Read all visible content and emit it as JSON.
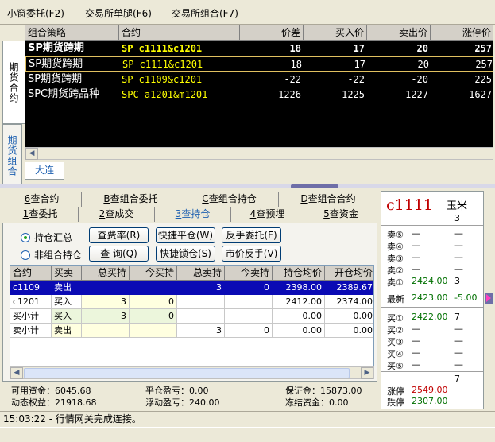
{
  "menubar": {
    "items": [
      "小窗委托(F2)",
      "交易所单腿(F6)",
      "交易所组合(F7)"
    ]
  },
  "left_tabs": [
    "期货合约",
    "期货组合"
  ],
  "quote_grid": {
    "headers": [
      "组合策略",
      "合约",
      "价差",
      "买入价",
      "卖出价",
      "涨停价"
    ],
    "rows": [
      {
        "strategy": "SP期货跨期",
        "contract": "SP c1111&c1201",
        "spread": "18",
        "bid": "17",
        "ask": "20",
        "limit_up": "257"
      },
      {
        "strategy": "SP期货跨期",
        "contract": "SP c1111&c1201",
        "spread": "18",
        "bid": "17",
        "ask": "20",
        "limit_up": "257"
      },
      {
        "strategy": "SP期货跨期",
        "contract": "SP c1109&c1201",
        "spread": "-22",
        "bid": "-22",
        "ask": "-20",
        "limit_up": "225"
      },
      {
        "strategy": "SPC期货跨品种",
        "contract": "SPC a1201&m1201",
        "spread": "1226",
        "bid": "1225",
        "ask": "1227",
        "limit_up": "1627"
      }
    ]
  },
  "exchange_tab": "大连",
  "lower_tabs": {
    "row1": [
      {
        "key": "6",
        "label": "查合约"
      },
      {
        "key": "B",
        "label": "查组合委托"
      },
      {
        "key": "C",
        "label": "查组合持仓"
      },
      {
        "key": "D",
        "label": "查组合合约"
      }
    ],
    "row2": [
      {
        "key": "1",
        "label": "查委托"
      },
      {
        "key": "2",
        "label": "查成交"
      },
      {
        "key": "3",
        "label": "查持仓"
      },
      {
        "key": "4",
        "label": "查预埋"
      },
      {
        "key": "5",
        "label": "查资金"
      }
    ]
  },
  "radios": {
    "summary": "持仓汇总",
    "non_combo": "非组合持仓"
  },
  "buttons": {
    "fee_rate": "查费率(R)",
    "quick_close": "快捷平仓(W)",
    "reverse_order": "反手委托(F)",
    "query": "查 询(Q)",
    "quick_lock": "快捷锁仓(S)",
    "market_reverse": "市价反手(V)"
  },
  "positions": {
    "headers": [
      "合约",
      "买卖",
      "总买持",
      "今买持",
      "总卖持",
      "今卖持",
      "持仓均价",
      "开仓均价"
    ],
    "rows": [
      {
        "contract": "c1109",
        "side": "卖出",
        "total_buy": "",
        "today_buy": "",
        "total_sell": "3",
        "today_sell": "0",
        "avg_price": "2398.00",
        "open_price": "2389.67"
      },
      {
        "contract": "c1201",
        "side": "买入",
        "total_buy": "3",
        "today_buy": "0",
        "total_sell": "",
        "today_sell": "",
        "avg_price": "2412.00",
        "open_price": "2374.00"
      },
      {
        "contract": "买小计",
        "side": "买入",
        "total_buy": "3",
        "today_buy": "0",
        "total_sell": "",
        "today_sell": "",
        "avg_price": "0.00",
        "open_price": "0.00"
      },
      {
        "contract": "卖小计",
        "side": "卖出",
        "total_buy": "",
        "today_buy": "",
        "total_sell": "3",
        "today_sell": "0",
        "avg_price": "0.00",
        "open_price": "0.00"
      }
    ]
  },
  "funds": {
    "available": "可用资金：6045.68",
    "close_pnl": "平仓盈亏：0.00",
    "margin": "保证金：15873.00",
    "dynamic_equity": "动态权益：21918.68",
    "float_pnl": "浮动盈亏：240.00",
    "frozen": "冻结资金：0.00"
  },
  "quote_panel": {
    "symbol": "c1111",
    "name": "玉米",
    "count": "3",
    "asks": [
      {
        "label": "卖⑤",
        "price": "—",
        "vol": "—"
      },
      {
        "label": "卖④",
        "price": "—",
        "vol": "—"
      },
      {
        "label": "卖③",
        "price": "—",
        "vol": "—"
      },
      {
        "label": "卖②",
        "price": "—",
        "vol": "—"
      },
      {
        "label": "卖①",
        "price": "2424.00",
        "vol": "3"
      }
    ],
    "last": {
      "label": "最新",
      "price": "2423.00",
      "change": "-5.00"
    },
    "bids": [
      {
        "label": "买①",
        "price": "2422.00",
        "vol": "7"
      },
      {
        "label": "买②",
        "price": "—",
        "vol": "—"
      },
      {
        "label": "买③",
        "price": "—",
        "vol": "—"
      },
      {
        "label": "买④",
        "price": "—",
        "vol": "—"
      },
      {
        "label": "买⑤",
        "price": "—",
        "vol": "—"
      }
    ],
    "volume": "7",
    "limit_up": {
      "label": "涨停",
      "price": "2549.00"
    },
    "limit_down": {
      "label": "跌停",
      "price": "2307.00"
    }
  },
  "status": "15:03:22 - 行情网关完成连接。",
  "colors": {
    "quote_bg": "#000000",
    "contract_text": "#ffff00",
    "selected_row": "#0a0ab4",
    "accent_blue": "#1c5fb0",
    "up_red": "#c00000",
    "green": "#007000"
  }
}
